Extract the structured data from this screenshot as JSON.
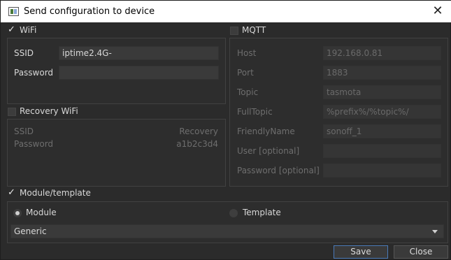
{
  "window": {
    "title": "Send configuration to device"
  },
  "wifi": {
    "title": "WiFi",
    "ssid_label": "SSID",
    "ssid_value": "iptime2.4G-",
    "password_label": "Password",
    "password_value": ""
  },
  "recovery": {
    "title": "Recovery WiFi",
    "ssid_label": "SSID",
    "ssid_value": "Recovery",
    "password_label": "Password",
    "password_value": "a1b2c3d4"
  },
  "mqtt": {
    "title": "MQTT",
    "host_label": "Host",
    "host_value": "192.168.0.81",
    "port_label": "Port",
    "port_value": "1883",
    "topic_label": "Topic",
    "topic_value": "tasmota",
    "fulltopic_label": "FullTopic",
    "fulltopic_value": "%prefix%/%topic%/",
    "friendlyname_label": "FriendlyName",
    "friendlyname_value": "sonoff_1",
    "user_label": "User [optional]",
    "user_value": "",
    "password_label": "Password [optional]",
    "password_value": ""
  },
  "module": {
    "title": "Module/template",
    "module_label": "Module",
    "template_label": "Template",
    "selected": "Generic"
  },
  "buttons": {
    "save": "Save",
    "close": "Close"
  }
}
